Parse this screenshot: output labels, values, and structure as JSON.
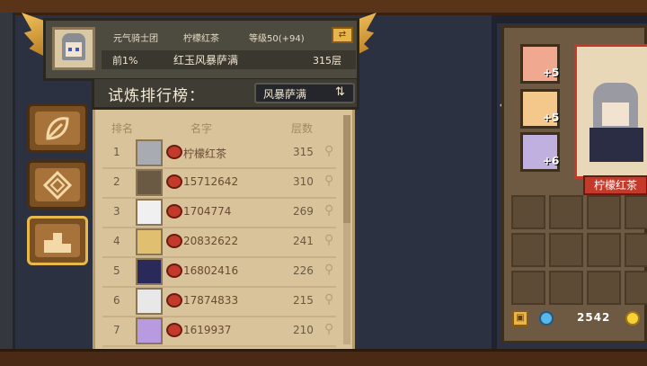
{
  "header": {
    "guild": "元气骑士团",
    "name": "柠檬红茶",
    "level": "等级50(+94)",
    "percentile": "前1%",
    "mode_title": "红玉风暴萨满",
    "floor": "315层"
  },
  "ranking": {
    "title": "试炼排行榜：",
    "mode_button": "风暴萨满",
    "columns": {
      "rank": "排名",
      "name": "名字",
      "score": "层数"
    },
    "rows": [
      {
        "rank": "1",
        "name": "柠檬红茶",
        "score": "315",
        "avatar_color": "#a9abb2"
      },
      {
        "rank": "2",
        "name": "15712642",
        "score": "310",
        "avatar_color": "#6a5a44"
      },
      {
        "rank": "3",
        "name": "1704774",
        "score": "269",
        "avatar_color": "#f0f0f0"
      },
      {
        "rank": "4",
        "name": "20832622",
        "score": "241",
        "avatar_color": "#e0c070"
      },
      {
        "rank": "5",
        "name": "16802416",
        "score": "226",
        "avatar_color": "#2a2a5a"
      },
      {
        "rank": "6",
        "name": "17874833",
        "score": "215",
        "avatar_color": "#e8e8e8"
      },
      {
        "rank": "7",
        "name": "1619937",
        "score": "210",
        "avatar_color": "#b89ae0"
      }
    ]
  },
  "character": {
    "name": "柠檬红茶",
    "slots": [
      {
        "level": "+5",
        "color": "#f0a890"
      },
      {
        "level": "+5",
        "color": "#f4c88a"
      },
      {
        "level": "+6",
        "color": "#c0b0e0"
      }
    ]
  },
  "currency": {
    "gems": "2542"
  },
  "icons": {
    "sync": "sync-icon",
    "refresh": "refresh-icon",
    "search": "search-icon",
    "lock": "lock-icon",
    "gem": "gem-icon",
    "coin": "coin-icon"
  }
}
